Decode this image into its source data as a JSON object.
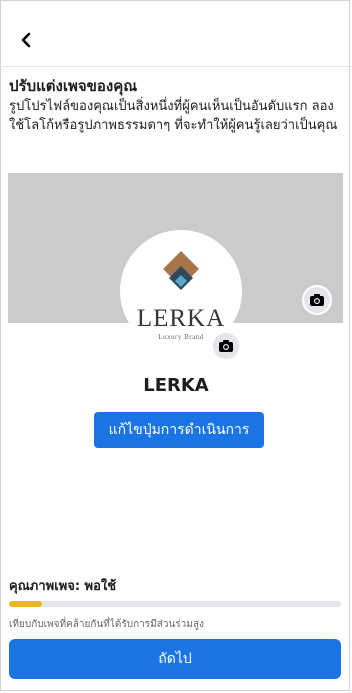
{
  "header": {
    "back_icon": "chevron-left-icon"
  },
  "title": "ปรับแต่งเพจของคุณ",
  "description": "รูปโปรไฟล์ของคุณเป็นสิ่งหนึ่งที่ผู้คนเห็นเป็นอันดับแรก ลองใช้โลโก้หรือรูปภาพธรรมดาๆ ที่จะทำให้ผู้คนรู้เลยว่าเป็นคุณ",
  "profile": {
    "logo_text": "LERKA",
    "logo_subtext": "Luxury Brand",
    "page_name": "LERKA",
    "logo_colors": {
      "diamond": "#a6764a",
      "inner": "#2c4a5b",
      "gem": "#5aa8c8"
    }
  },
  "action_button": {
    "label": "แก้ไขปุ่มการดำเนินการ"
  },
  "quality": {
    "label": "คุณภาพเพจ: พอใช้",
    "progress": 0.1,
    "note": "เทียบกับเพจที่คล้ายกันที่ได้รับการมีส่วนร่วมสูง"
  },
  "next_button": {
    "label": "ถัดไป"
  },
  "colors": {
    "primary": "#1b74e4",
    "progress": "#f0b429",
    "cover": "#cacbcd"
  }
}
